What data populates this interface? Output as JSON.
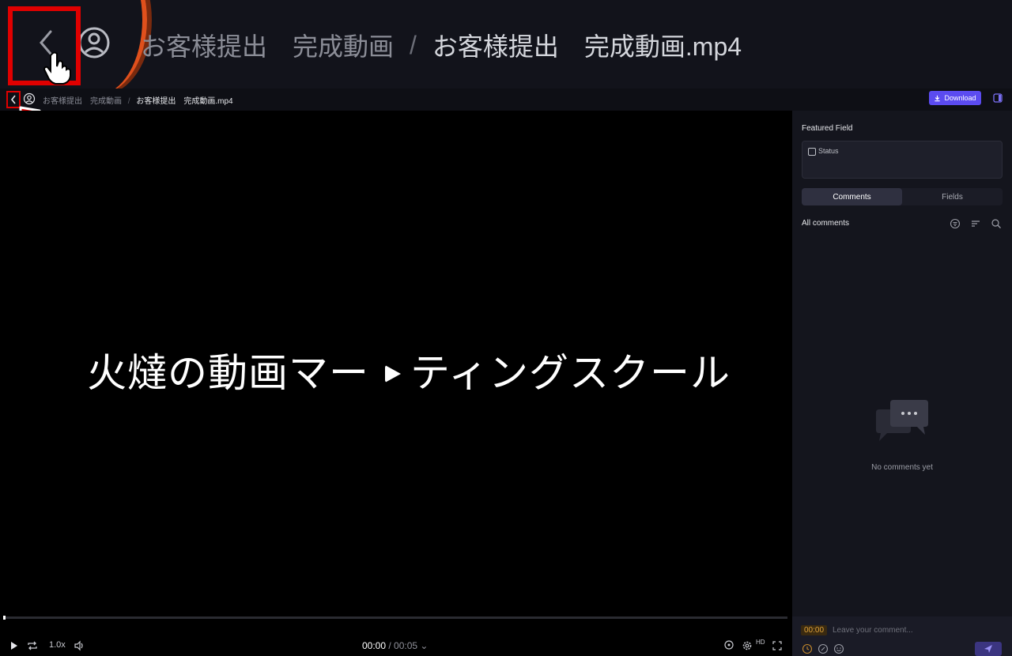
{
  "zoom_header": {
    "breadcrumb_folder": "お客様提出　完成動画",
    "separator": "/",
    "breadcrumb_file": "お客様提出　完成動画.mp4"
  },
  "topbar": {
    "breadcrumb_folder": "お客様提出　完成動画",
    "separator": "/",
    "breadcrumb_file": "お客様提出　完成動画.mp4",
    "download_label": "Download"
  },
  "video": {
    "title_left": "火燵の動画マー",
    "title_right": "ティングスクール"
  },
  "controls": {
    "speed": "1.0x",
    "current_time": "00:00",
    "time_separator": " / ",
    "duration": "00:05",
    "quality": "HD",
    "progress": 0
  },
  "sidebar": {
    "featured_field_title": "Featured Field",
    "status_label": "Status",
    "tabs": [
      {
        "label": "Comments",
        "active": true
      },
      {
        "label": "Fields",
        "active": false
      }
    ],
    "all_comments": "All comments",
    "empty_text": "No comments yet",
    "composer": {
      "timecode": "00:00",
      "placeholder": "Leave your comment..."
    }
  },
  "colors": {
    "accent": "#5b4bf0",
    "annotation_red": "#e00000",
    "timecode": "#e0a33a"
  }
}
